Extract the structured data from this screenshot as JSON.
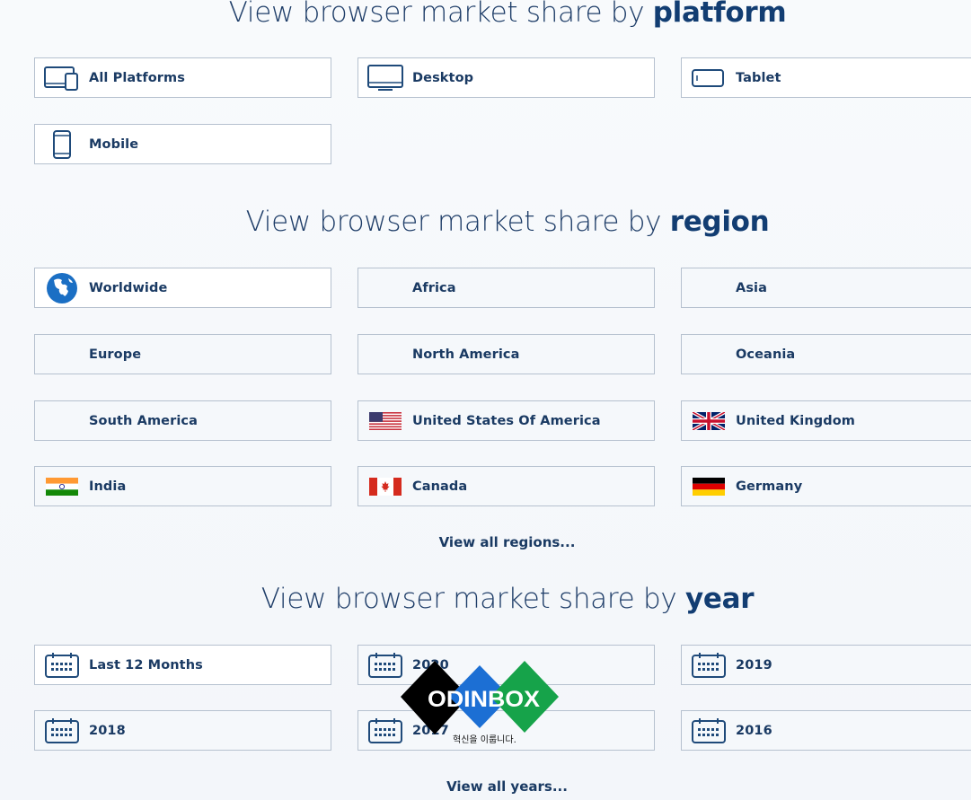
{
  "platform_section": {
    "heading_prefix": "View browser market share by ",
    "heading_bold": "platform",
    "tiles": [
      {
        "label": "All Platforms",
        "icon": "all-platforms-icon"
      },
      {
        "label": "Desktop",
        "icon": "desktop-icon"
      },
      {
        "label": "Tablet",
        "icon": "tablet-icon"
      },
      {
        "label": "Mobile",
        "icon": "mobile-icon"
      }
    ]
  },
  "region_section": {
    "heading_prefix": "View browser market share by ",
    "heading_bold": "region",
    "tiles": [
      {
        "label": "Worldwide",
        "icon": "globe-icon"
      },
      {
        "label": "Africa"
      },
      {
        "label": "Asia"
      },
      {
        "label": "Europe"
      },
      {
        "label": "North America"
      },
      {
        "label": "Oceania"
      },
      {
        "label": "South America"
      },
      {
        "label": "United States Of America",
        "icon": "usa-flag-icon"
      },
      {
        "label": "United Kingdom",
        "icon": "uk-flag-icon"
      },
      {
        "label": "India",
        "icon": "india-flag-icon"
      },
      {
        "label": "Canada",
        "icon": "canada-flag-icon"
      },
      {
        "label": "Germany",
        "icon": "germany-flag-icon"
      }
    ],
    "view_all": "View all regions..."
  },
  "year_section": {
    "heading_prefix": "View browser market share by ",
    "heading_bold": "year",
    "tiles": [
      {
        "label": "Last 12 Months",
        "icon": "calendar-icon"
      },
      {
        "label": "2020",
        "icon": "calendar-icon"
      },
      {
        "label": "2019",
        "icon": "calendar-icon"
      },
      {
        "label": "2018",
        "icon": "calendar-icon"
      },
      {
        "label": "2017",
        "icon": "calendar-icon"
      },
      {
        "label": "2016",
        "icon": "calendar-icon"
      }
    ],
    "view_all": "View all years..."
  },
  "watermark": {
    "brand": "ODINBOX",
    "tagline": "혁신을 이룹니다."
  },
  "colors": {
    "text": "#1a3a63",
    "heading_bold": "#123d72",
    "tile_border": "#b6c1cf",
    "icon_blue": "#1f4a7a",
    "globe_blue": "#1b6fc4"
  }
}
